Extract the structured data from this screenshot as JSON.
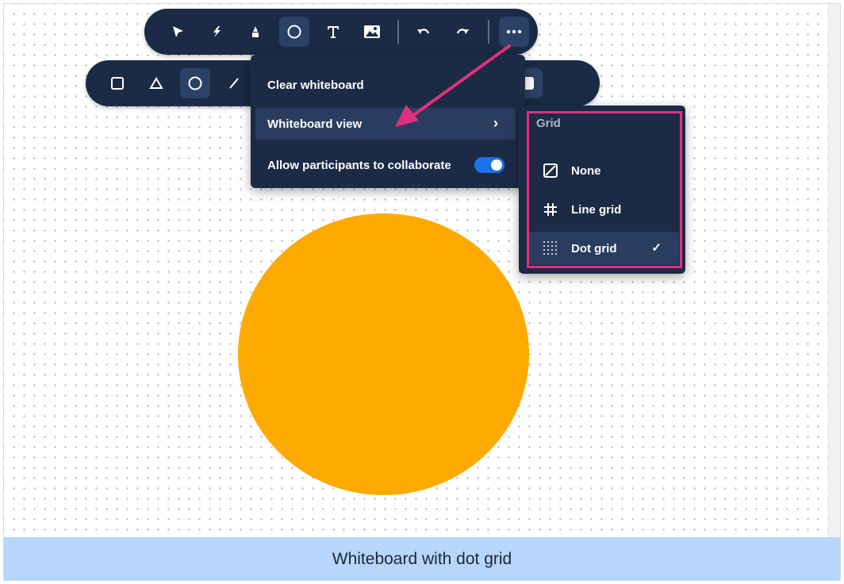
{
  "caption": "Whiteboard with dot grid",
  "canvas": {
    "shape_color": "#ffaa00",
    "grid_style": "dot"
  },
  "main_toolbar": {
    "tools": [
      "select-icon",
      "laser-icon",
      "highlighter-icon",
      "circle-icon",
      "text-icon",
      "image-icon",
      "undo-icon",
      "redo-icon",
      "more-icon"
    ],
    "active": [
      "circle-icon",
      "more-icon"
    ]
  },
  "shape_toolbar": {
    "tools": [
      "square-icon",
      "triangle-icon",
      "circle-icon",
      "line-icon",
      "outline-square-icon",
      "filled-square-icon"
    ],
    "active": [
      "circle-icon",
      "filled-square-icon"
    ]
  },
  "more_menu": {
    "clear_label": "Clear whiteboard",
    "view_label": "Whiteboard view",
    "view_chevron": "›",
    "collaborate_label": "Allow participants to collaborate",
    "collaborate_enabled": true
  },
  "grid_submenu": {
    "title": "Grid",
    "items": [
      {
        "label": "None",
        "icon": "no-grid-icon"
      },
      {
        "label": "Line grid",
        "icon": "line-grid-icon"
      },
      {
        "label": "Dot grid",
        "icon": "dot-grid-icon"
      }
    ],
    "selected": "Dot grid",
    "check": "✓"
  },
  "colors": {
    "toolbar_bg": "#1b2a45",
    "accent": "#1a73e8",
    "annotation": "#e0307d",
    "caption_bg": "#b7d6fb"
  }
}
